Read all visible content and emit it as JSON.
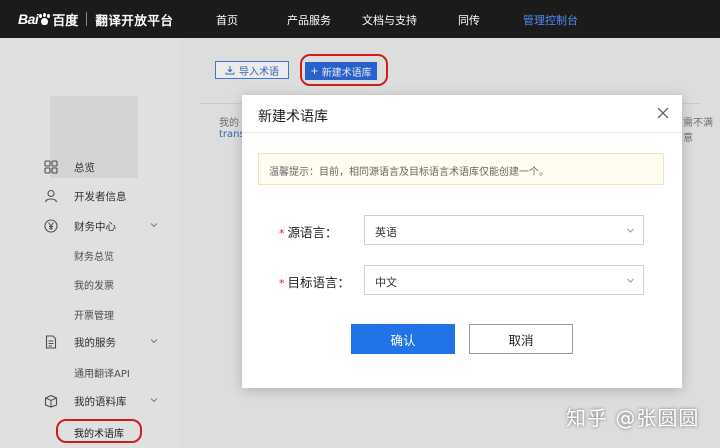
{
  "logo": {
    "baidu": "Bai",
    "baidu_cn": "百度",
    "platform": "翻译开放平台"
  },
  "nav": {
    "items": [
      {
        "label": "首页"
      },
      {
        "label": "产品服务"
      },
      {
        "label": "文档与支持"
      },
      {
        "label": "同传"
      },
      {
        "label": "管理控制台",
        "active": true
      }
    ]
  },
  "sidebar": {
    "items": [
      {
        "label": "总览",
        "icon": "grid-icon"
      },
      {
        "label": "开发者信息",
        "icon": "user-icon"
      },
      {
        "label": "财务中心",
        "icon": "yen-icon"
      },
      {
        "label": "我的服务",
        "icon": "document-icon"
      },
      {
        "label": "我的语料库",
        "icon": "box-icon"
      }
    ],
    "sub_finance": [
      "财务总览",
      "我的发票",
      "开票管理"
    ],
    "sub_service": [
      "通用翻译API"
    ],
    "sub_corpus": [
      "我的术语库"
    ]
  },
  "toolbar": {
    "import_label": "导入术语",
    "new_label": "新建术语库",
    "new_prefix": "+"
  },
  "background_text": {
    "left_fragment": "我的",
    "link_fragment": "trans",
    "right_fragment": "需不满意"
  },
  "modal": {
    "title": "新建术语库",
    "tip": "温馨提示：目前，相同源语言及目标语言术语库仅能创建一个。",
    "source_label": "源语言：",
    "source_value": "英语",
    "target_label": "目标语言：",
    "target_value": "中文",
    "required_mark": "*",
    "ok_label": "确认",
    "cancel_label": "取消"
  },
  "watermark": "知乎 @张圆圆",
  "colors": {
    "nav_bg": "#1b1b1b",
    "nav_active": "#4f8ef7",
    "primary": "#2273e8",
    "highlight": "#e02020"
  }
}
